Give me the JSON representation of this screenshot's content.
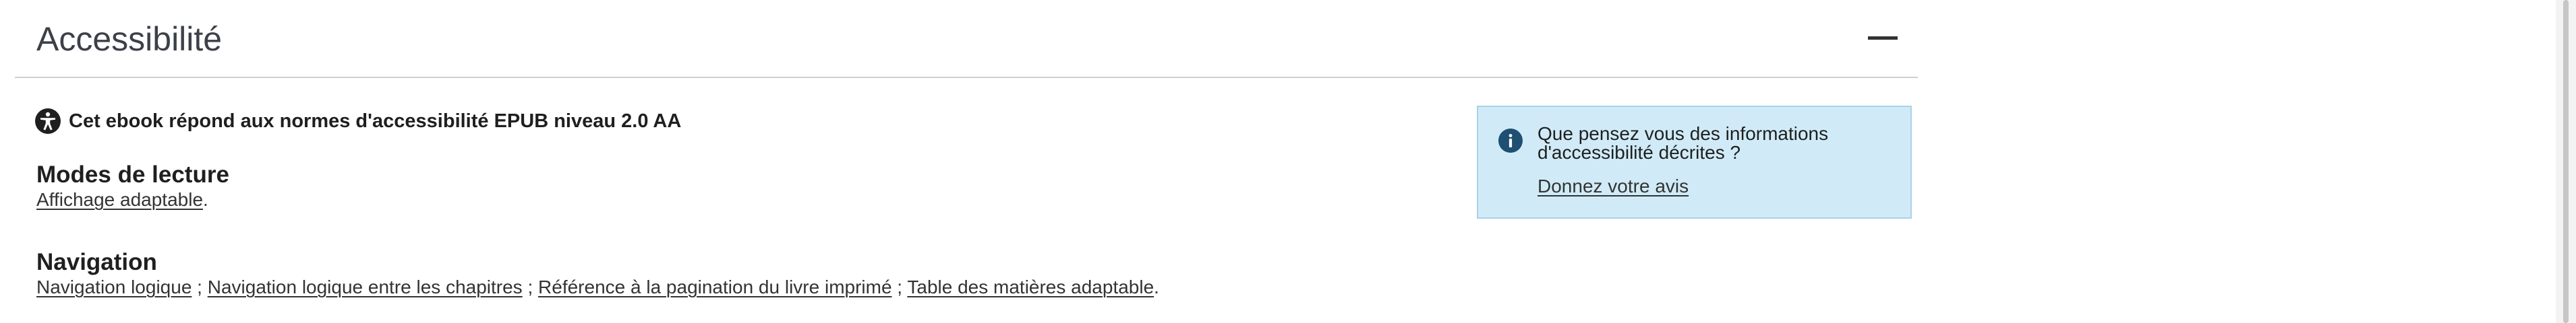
{
  "section": {
    "title": "Accessibilité",
    "collapse_icon": "minus-icon"
  },
  "conformance": {
    "icon": "accessibility-icon",
    "text": "Cet ebook répond aux normes d'accessibilité EPUB niveau 2.0 AA"
  },
  "reading_modes": {
    "title": "Modes de lecture",
    "items": [
      "Affichage adaptable"
    ]
  },
  "navigation": {
    "title": "Navigation",
    "items": [
      "Navigation logique",
      "Navigation logique entre les chapitres",
      "Référence à la pagination du livre imprimé",
      "Table des matières adaptable"
    ]
  },
  "feedback": {
    "icon": "info-icon",
    "question": "Que pensez vous des informations d'accessibilité décrites ?",
    "link": "Donnez votre avis",
    "background_color": "#d0ebf7",
    "icon_color": "#1f4f72"
  },
  "separators": {
    "item": " ; ",
    "end": "."
  }
}
